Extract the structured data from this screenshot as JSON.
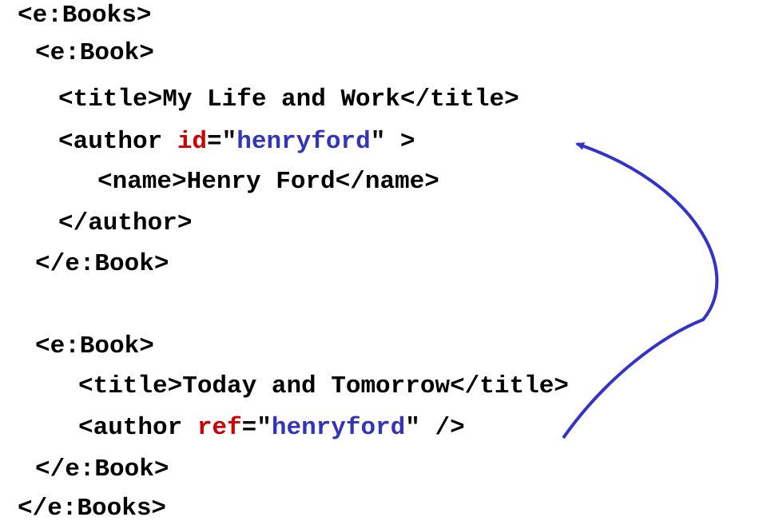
{
  "colors": {
    "text": "#000000",
    "attribute_name": "#cc0000",
    "attribute_value": "#3333bb",
    "arrow": "#3333cc"
  },
  "lines": [
    {
      "text": "<e:Books>"
    },
    {
      "text": "<e:Book>"
    },
    {
      "text": "<title>My Life and Work</title>"
    },
    {
      "pre": "<author ",
      "attr": "id",
      "eq": "=\"",
      "value": "henryford",
      "post": "\" >"
    },
    {
      "text": "<name>Henry Ford</name>"
    },
    {
      "text": "</author>"
    },
    {
      "text": "</e:Book>"
    },
    {
      "text": "<e:Book>"
    },
    {
      "text": "<title>Today and Tomorrow</title>"
    },
    {
      "pre": "<author ",
      "attr": "ref",
      "eq": "=\"",
      "value": "henryford",
      "post": "\" />"
    },
    {
      "text": "</e:Book>"
    },
    {
      "text": "</e:Books>"
    }
  ],
  "arrow": {
    "from": "ref attribute (second book author)",
    "to": "id attribute (first book author)"
  }
}
